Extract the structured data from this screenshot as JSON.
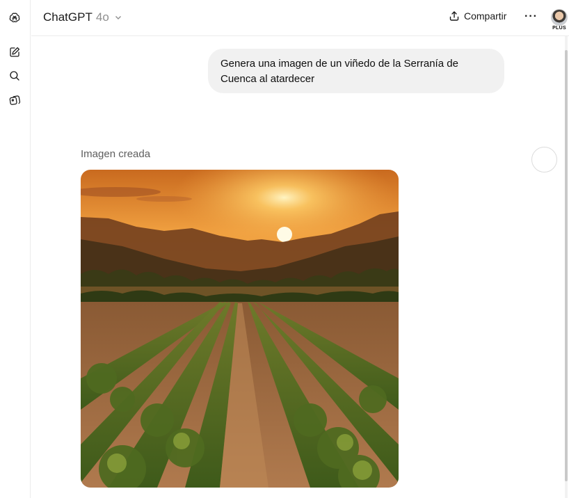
{
  "header": {
    "model_name": "ChatGPT",
    "model_version": "4o",
    "share_label": "Compartir",
    "more_label": "···",
    "plan_badge": "PLUS"
  },
  "rail": {
    "icons": [
      "openai-logo-icon",
      "new-chat-icon",
      "search-icon",
      "library-icon"
    ]
  },
  "conversation": {
    "user_message": "Genera una imagen de un viñedo de la Serranía de Cuenca al atardecer",
    "assistant_label": "Imagen creada",
    "image_subject": "vineyard-sunset"
  },
  "colors": {
    "bubble_bg": "#f1f1f1",
    "border": "#ececec",
    "muted_text": "#8f8f8f"
  }
}
